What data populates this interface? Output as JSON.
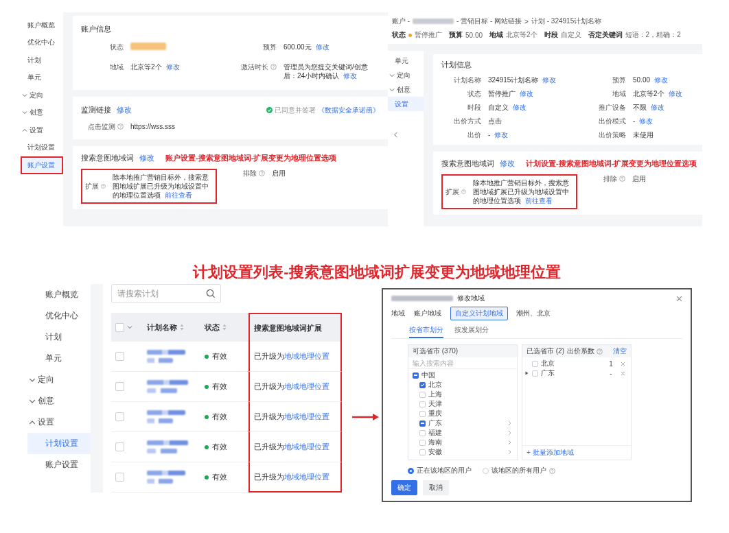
{
  "account_settings": {
    "sidebar": [
      {
        "label": "账户概览",
        "kind": "item",
        "selected": false,
        "annotated": false
      },
      {
        "label": "优化中心",
        "kind": "item",
        "selected": false,
        "annotated": false
      },
      {
        "label": "计划",
        "kind": "item",
        "selected": false,
        "annotated": false
      },
      {
        "label": "单元",
        "kind": "item",
        "selected": false,
        "annotated": false
      },
      {
        "label": "定向",
        "kind": "group",
        "expanded": false,
        "selected": false,
        "annotated": false
      },
      {
        "label": "创意",
        "kind": "group",
        "expanded": false,
        "selected": false,
        "annotated": false
      },
      {
        "label": "设置",
        "kind": "group",
        "expanded": true,
        "selected": false,
        "annotated": false
      },
      {
        "label": "计划设置",
        "kind": "sub",
        "selected": false,
        "annotated": false
      },
      {
        "label": "账户设置",
        "kind": "sub",
        "selected": true,
        "annotated": true
      }
    ],
    "account_info": {
      "title": "账户信息",
      "fields": [
        {
          "label": "状态",
          "kind": "blurred",
          "help": false
        },
        {
          "label": "预算",
          "kind": "text",
          "value": "600.00元",
          "link": "修改",
          "help": false
        },
        {
          "label": "地域",
          "kind": "text",
          "value": "北京等2个",
          "link": "修改",
          "help": false
        },
        {
          "label": "激活时长",
          "kind": "text",
          "value": "管理员为您提交关键词/创意后：24小时内确认",
          "link": "修改",
          "help": true
        }
      ]
    },
    "monitor": {
      "title": "监测链接",
      "link": "修改",
      "agreement": "已同意并签署",
      "agreement_link": "《数据安全承诺函》",
      "fields": [
        {
          "label": "点击监测",
          "kind": "text",
          "value": "https://wss.sss",
          "help": true
        }
      ]
    },
    "geo_words": {
      "title": "搜索意图地域词",
      "link": "修改",
      "annotation": "账户设置-搜索意图地域词-扩展变更为地理位置选项",
      "fields": [
        {
          "label": "扩展",
          "kind": "text",
          "value": "除本地推广营销目标外，搜索意图地域扩展已升级为地域设置中的地理位置选项",
          "link": "前往查看",
          "help": true,
          "annotated": true
        },
        {
          "label": "排除",
          "kind": "text",
          "value": "启用",
          "help": true,
          "annotated": false
        }
      ]
    }
  },
  "plan_settings": {
    "breadcrumb": [
      {
        "kind": "text",
        "text": "账户 -"
      },
      {
        "kind": "blurred"
      },
      {
        "kind": "text",
        "text": "- 营销目标 - 网站链接"
      },
      {
        "kind": "separator",
        "text": ">"
      },
      {
        "kind": "text",
        "text": "计划 - 324915计划名称"
      }
    ],
    "summary": {
      "status": {
        "label": "状态",
        "value": "暂停推广",
        "color": "#f2a51f"
      },
      "items": [
        {
          "label": "预算",
          "value": "50.00"
        },
        {
          "label": "地域",
          "value": "北京等2个"
        },
        {
          "label": "时段",
          "value": "自定义"
        },
        {
          "label": "否定关键词",
          "value": "短语：2，精确：2"
        }
      ]
    },
    "sidebar": [
      {
        "label": "单元",
        "kind": "item",
        "selected": false
      },
      {
        "label": "定向",
        "kind": "group",
        "expanded": false,
        "selected": false
      },
      {
        "label": "创意",
        "kind": "group",
        "expanded": false,
        "selected": false
      },
      {
        "label": "设置",
        "kind": "item",
        "selected": true
      }
    ],
    "plan_info": {
      "title": "计划信息",
      "fields": [
        {
          "label": "计划名称",
          "kind": "text",
          "value": "324915计划名称",
          "link": "修改",
          "help": false
        },
        {
          "label": "预算",
          "kind": "text",
          "value": "50.00",
          "link": "修改",
          "help": false
        },
        {
          "label": "状态",
          "kind": "text",
          "value": "暂停推广",
          "link": "修改",
          "help": false
        },
        {
          "label": "地域",
          "kind": "text",
          "value": "北京等2个",
          "link": "修改",
          "help": false
        },
        {
          "label": "时段",
          "kind": "text",
          "value": "自定义",
          "link": "修改",
          "help": false
        },
        {
          "label": "推广设备",
          "kind": "text",
          "value": "不限",
          "link": "修改",
          "help": false
        },
        {
          "label": "出价方式",
          "kind": "text",
          "value": "点击",
          "help": false
        },
        {
          "label": "出价模式",
          "kind": "text",
          "value": "-",
          "link": "修改",
          "help": false
        },
        {
          "label": "出价",
          "kind": "text",
          "value": "-",
          "link": "修改",
          "help": false
        },
        {
          "label": "出价策略",
          "kind": "text",
          "value": "未使用",
          "help": false
        }
      ]
    },
    "geo_words": {
      "title": "搜索意图地域词",
      "link": "修改",
      "annotation": "计划设置-搜索意图地域词-扩展变更为地理位置选项",
      "fields": [
        {
          "label": "扩展",
          "kind": "text",
          "value": "除本地推广营销目标外，搜索意图地域扩展已升级为地域设置中的地理位置选项",
          "link": "前往查看",
          "help": true,
          "annotated": true
        },
        {
          "label": "排除",
          "kind": "text",
          "value": "启用",
          "help": true,
          "annotated": false
        }
      ]
    }
  },
  "comparison_title": "计划设置列表-搜索意图地域词扩展变更为地域地理位置",
  "plan_list": {
    "sidebar": [
      {
        "label": "账户概览",
        "kind": "item",
        "selected": false
      },
      {
        "label": "优化中心",
        "kind": "item",
        "selected": false
      },
      {
        "label": "计划",
        "kind": "item",
        "selected": false
      },
      {
        "label": "单元",
        "kind": "item",
        "selected": false
      },
      {
        "label": "定向",
        "kind": "group",
        "expanded": false,
        "selected": false
      },
      {
        "label": "创意",
        "kind": "group",
        "expanded": false,
        "selected": false
      },
      {
        "label": "设置",
        "kind": "group",
        "expanded": true,
        "selected": false
      },
      {
        "label": "计划设置",
        "kind": "sub",
        "selected": true
      },
      {
        "label": "账户设置",
        "kind": "sub",
        "selected": false
      }
    ],
    "search": {
      "placeholder": "请搜索计划"
    },
    "table": {
      "select_all": {
        "checked": false
      },
      "columns": [
        {
          "label": "计划名称",
          "sortable": true,
          "annotated": false
        },
        {
          "label": "状态",
          "sortable": true,
          "annotated": false
        },
        {
          "label": "搜索意图地域词扩展",
          "sortable": false,
          "annotated": true
        }
      ],
      "rows": [
        {
          "checked": false,
          "status": "有效",
          "note": "已升级为",
          "link": "地域地理位置"
        },
        {
          "checked": false,
          "status": "有效",
          "note": "已升级为",
          "link": "地域地理位置"
        },
        {
          "checked": false,
          "status": "有效",
          "note": "已升级为",
          "link": "地域地理位置"
        },
        {
          "checked": false,
          "status": "有效",
          "note": "已升级为",
          "link": "地域地理位置"
        },
        {
          "checked": false,
          "status": "有效",
          "note": "已升级为",
          "link": "地域地理位置"
        }
      ]
    }
  },
  "region_dialog": {
    "title_parts": [
      {
        "kind": "blurred"
      },
      {
        "kind": "text",
        "text": "修改地域"
      }
    ],
    "scope_label": "地域",
    "scope_options": [
      {
        "label": "账户地域",
        "selected": false
      },
      {
        "label": "自定义计划地域",
        "selected": true
      }
    ],
    "scope_value": "潮州、北京",
    "subtabs": [
      {
        "label": "按省市划分",
        "selected": true
      },
      {
        "label": "按发展划分",
        "selected": false
      }
    ],
    "available": {
      "title": "可选省市 (370)",
      "search_placeholder": "输入搜索内容",
      "tree": [
        {
          "label": "中国",
          "checked": false,
          "partial": true,
          "expandable": false,
          "children": [
            {
              "label": "北京",
              "checked": true,
              "partial": false,
              "expandable": false
            },
            {
              "label": "上海",
              "checked": false,
              "partial": false,
              "expandable": false
            },
            {
              "label": "天津",
              "checked": false,
              "partial": false,
              "expandable": false
            },
            {
              "label": "重庆",
              "checked": false,
              "partial": false,
              "expandable": false
            },
            {
              "label": "广东",
              "checked": false,
              "partial": true,
              "expandable": true
            },
            {
              "label": "福建",
              "checked": false,
              "partial": false,
              "expandable": true
            },
            {
              "label": "海南",
              "checked": false,
              "partial": false,
              "expandable": true
            },
            {
              "label": "安徽",
              "checked": false,
              "partial": false,
              "expandable": true
            }
          ]
        }
      ]
    },
    "chosen": {
      "title": "已选省市 (2)",
      "coefficient_label": "出价系数",
      "clear": "清空",
      "rows": [
        {
          "label": "北京",
          "coefficient": "1",
          "expandable": false,
          "checked": false
        },
        {
          "label": "广东",
          "coefficient": "-",
          "expandable": true,
          "checked": false
        }
      ],
      "add_link": "+ 批量添加地域"
    },
    "audience": [
      {
        "label": "正在该地区的用户",
        "selected": true,
        "help": false
      },
      {
        "label": "该地区的所有用户",
        "selected": false,
        "help": true
      }
    ],
    "buttons": [
      {
        "label": "确定",
        "kind": "primary"
      },
      {
        "label": "取消",
        "kind": "secondary"
      }
    ]
  }
}
